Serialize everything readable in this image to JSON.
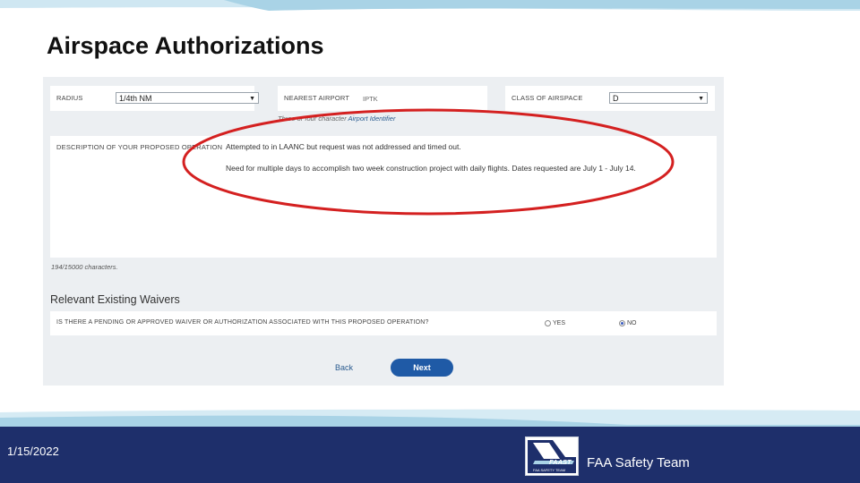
{
  "slide": {
    "title": "Airspace Authorizations",
    "date": "1/15/2022",
    "team": "FAA Safety Team"
  },
  "form": {
    "radius": {
      "label": "RADIUS",
      "value": "1/4th NM"
    },
    "nearest_airport": {
      "label": "NEAREST AIRPORT",
      "value": "IPTK"
    },
    "class_of_airspace": {
      "label": "CLASS OF AIRSPACE",
      "value": "D"
    },
    "airport_hint_prefix": "Three or four character",
    "airport_hint_link": "Airport Identifier",
    "description_label": "DESCRIPTION OF YOUR PROPOSED OPERATION",
    "description_lines": [
      "Attempted to in LAANC but request was not addressed and timed out.",
      "Need for multiple days to accomplish two week construction project with daily flights. Dates requested are July 1 - July 14."
    ],
    "char_count": "194/15000 characters."
  },
  "waivers": {
    "title": "Relevant Existing Waivers",
    "question": "IS THERE A PENDING OR APPROVED WAIVER OR AUTHORIZATION ASSOCIATED WITH THIS PROPOSED OPERATION?",
    "yes_label": "YES",
    "no_label": "NO",
    "selected": "NO"
  },
  "nav": {
    "back_label": "Back",
    "next_label": "Next"
  },
  "logo": {
    "main_text": "FAAST",
    "sub_text": "FAA SAFETY TEAM"
  },
  "colors": {
    "footer_navy": "#1e2f6b",
    "band_light_blue": "#a9d3e6",
    "annotation_red": "#d42020",
    "button_blue": "#1f5aa6"
  }
}
